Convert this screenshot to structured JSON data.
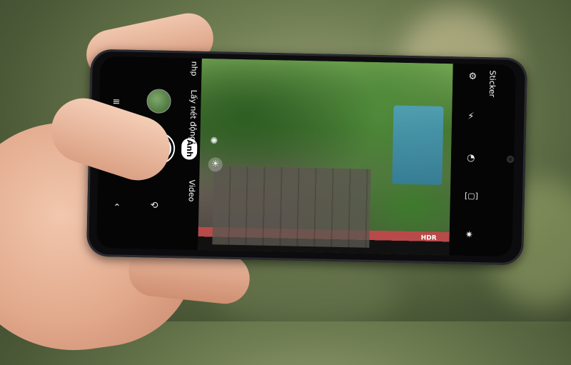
{
  "camera_ui": {
    "left_panel": {
      "modes": [
        "nhp",
        "Lấy nét động",
        "Ảnh",
        "Video"
      ],
      "icons": [
        "menu-icon",
        "gallery-thumbnail",
        "shutter-button",
        "switch-camera-icon",
        "chevron-up-icon"
      ]
    },
    "viewfinder": {
      "overlay_icons": [
        "filter-icon",
        "brightness-icon"
      ]
    },
    "right_panel": {
      "top_label": "Sticker",
      "icons": [
        "settings-icon",
        "flash-off-icon",
        "timer-off-icon",
        "aspect-ratio-icon",
        "hdr-icon",
        "effects-icon"
      ],
      "hdr_label": "HDR"
    }
  }
}
